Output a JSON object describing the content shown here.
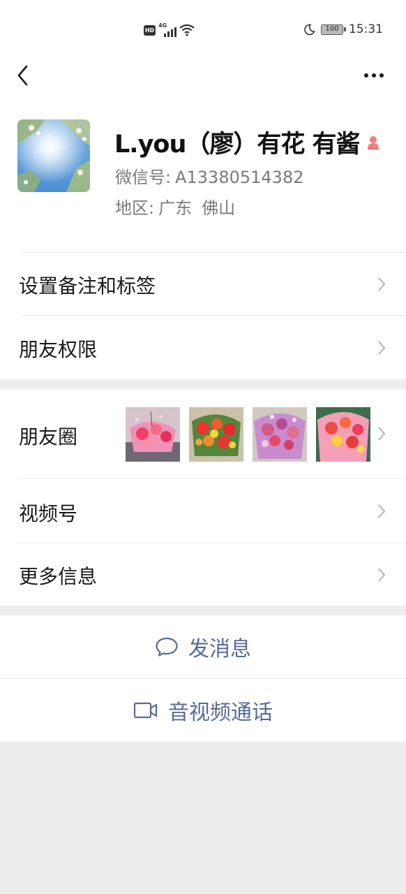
{
  "status_bar": {
    "hd": "HD",
    "network": "4G",
    "battery": "100",
    "time": "15:31"
  },
  "profile": {
    "nickname": "L.you（廖）有花 有酱",
    "wechat_id_label": "微信号:",
    "wechat_id": "A13380514382",
    "region_label": "地区:",
    "region_province": "广东",
    "region_city": "佛山"
  },
  "menu": {
    "remarks_tags": "设置备注和标签",
    "friend_permissions": "朋友权限",
    "moments": "朋友圈",
    "channels": "视频号",
    "more_info": "更多信息"
  },
  "actions": {
    "send_message": "发消息",
    "voice_video_call": "音视频通话"
  },
  "colors": {
    "link_blue": "#576b95",
    "gender_female": "#f37e7d",
    "background": "#ededed"
  },
  "icons": [
    "back-icon",
    "more-icon",
    "gender-icon",
    "chevron-right-icon",
    "chat-bubble-icon",
    "video-camera-icon"
  ]
}
